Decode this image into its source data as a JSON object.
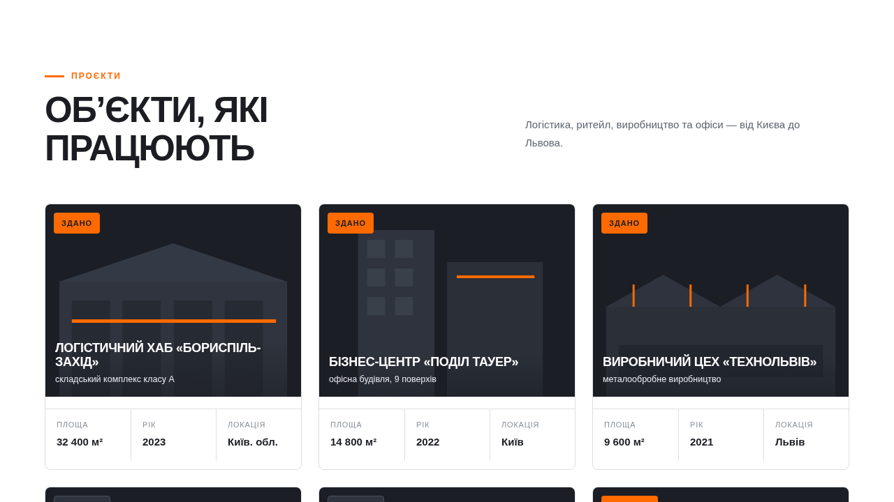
{
  "section": {
    "eyebrow": "ПРОЄКТИ",
    "title": "ОБ’ЄКТИ, ЯКІ ПРАЦЮЮТЬ",
    "lead": "Логістика, ритейл, виробництво та офіси — від Києва до Львова."
  },
  "projects": [
    {
      "kind": "warehouse",
      "badge": {
        "label": "ЗДАНО",
        "color": "#ff6a00"
      },
      "title": "ЛОГІСТИЧНИЙ ХАБ «БОРИСПІЛЬ-ЗАХІД»",
      "subtitle": "складський комплекс класу А",
      "stats": [
        {
          "label": "ПЛОЩА",
          "value": "32 400 м²"
        },
        {
          "label": "РІК",
          "value": "2023"
        },
        {
          "label": "ЛОКАЦІЯ",
          "value": "Київ. обл."
        }
      ]
    },
    {
      "kind": "office",
      "badge": {
        "label": "ЗДАНО",
        "color": "#ff6a00"
      },
      "title": "БІЗНЕС-ЦЕНТР «ПОДІЛ ТАУЕР»",
      "subtitle": "офісна будівля, 9 поверхів",
      "stats": [
        {
          "label": "ПЛОЩА",
          "value": "14 800 м²"
        },
        {
          "label": "РІК",
          "value": "2022"
        },
        {
          "label": "ЛОКАЦІЯ",
          "value": "Київ"
        }
      ]
    },
    {
      "kind": "factory",
      "badge": {
        "label": "ЗДАНО",
        "color": "#ff6a00"
      },
      "title": "ВИРОБНИЧИЙ ЦЕХ «ТЕХНОЛЬВІВ»",
      "subtitle": "металообробне виробництво",
      "stats": [
        {
          "label": "ПЛОЩА",
          "value": "9 600 м²"
        },
        {
          "label": "РІК",
          "value": "2021"
        },
        {
          "label": "ЛОКАЦІЯ",
          "value": "Львів"
        }
      ]
    },
    {
      "kind": "hidden",
      "badge": {
        "color": "#2e333d"
      }
    },
    {
      "kind": "hidden",
      "badge": {
        "color": "#2e333d"
      }
    },
    {
      "kind": "hidden",
      "badge": {
        "color": "#ff6a00"
      }
    }
  ]
}
